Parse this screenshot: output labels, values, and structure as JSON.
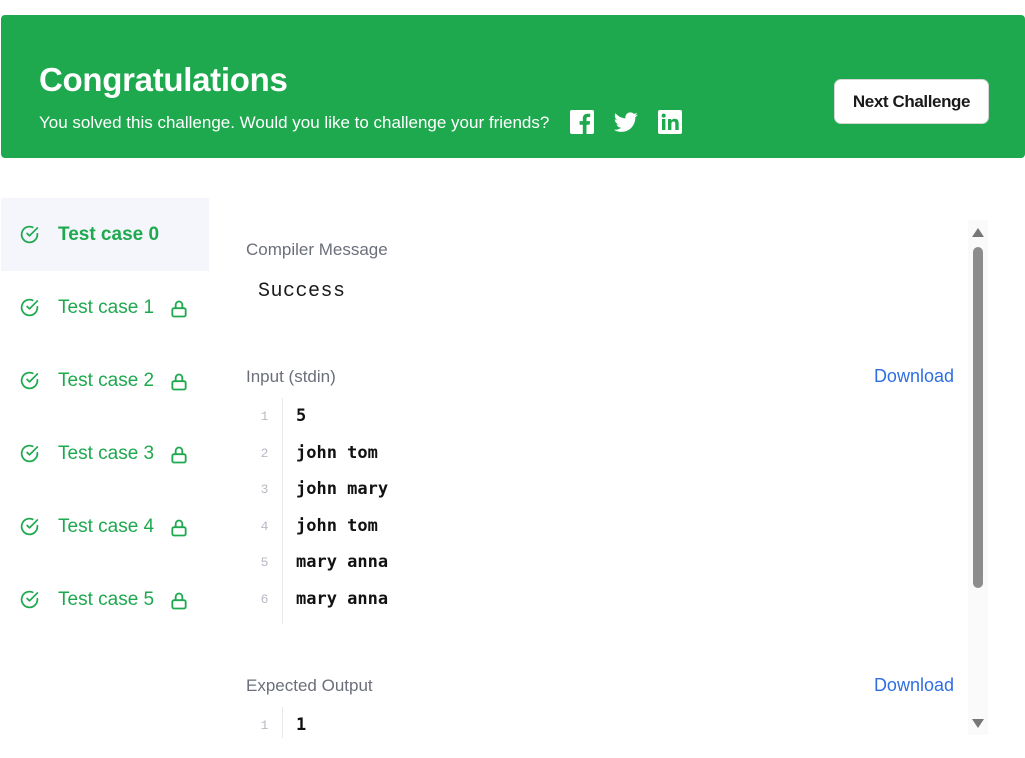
{
  "banner": {
    "title": "Congratulations",
    "subtitle": "You solved this challenge. Would you like to challenge your friends?",
    "social_icons": [
      "facebook-icon",
      "twitter-icon",
      "linkedin-icon"
    ],
    "next_button_label": "Next Challenge",
    "background_color": "#1ea94f"
  },
  "sidebar": {
    "items": [
      {
        "label": "Test case 0",
        "active": true,
        "passed": true,
        "locked": false
      },
      {
        "label": "Test case 1",
        "active": false,
        "passed": true,
        "locked": true
      },
      {
        "label": "Test case 2",
        "active": false,
        "passed": true,
        "locked": true
      },
      {
        "label": "Test case 3",
        "active": false,
        "passed": true,
        "locked": true
      },
      {
        "label": "Test case 4",
        "active": false,
        "passed": true,
        "locked": true
      },
      {
        "label": "Test case 5",
        "active": false,
        "passed": true,
        "locked": true
      }
    ],
    "accent_color": "#1ea94f"
  },
  "main": {
    "compiler": {
      "label": "Compiler Message",
      "message": "Success"
    },
    "input": {
      "label": "Input (stdin)",
      "download_label": "Download",
      "lines": [
        {
          "n": "1",
          "text": "5"
        },
        {
          "n": "2",
          "text": "john tom"
        },
        {
          "n": "3",
          "text": "john mary"
        },
        {
          "n": "4",
          "text": "john tom"
        },
        {
          "n": "5",
          "text": "mary anna"
        },
        {
          "n": "6",
          "text": "mary anna"
        }
      ]
    },
    "expected_output": {
      "label": "Expected Output",
      "download_label": "Download",
      "lines": [
        {
          "n": "1",
          "text": "1"
        }
      ]
    },
    "link_color": "#2f6fe0"
  }
}
